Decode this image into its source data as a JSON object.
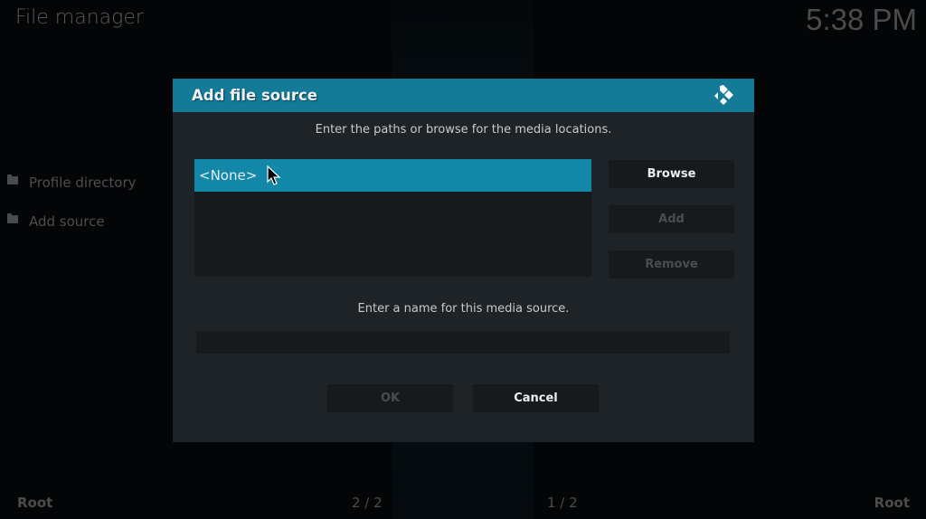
{
  "window": {
    "title": "File manager",
    "clock": "5:38 PM"
  },
  "left_panel": {
    "items": [
      {
        "label": "Profile directory",
        "icon": "folder-icon"
      },
      {
        "label": "Add source",
        "icon": "folder-icon"
      }
    ]
  },
  "footer": {
    "left_path": "Root",
    "left_count": "2 / 2",
    "right_count": "1 / 2",
    "right_path": "Root"
  },
  "dialog": {
    "title": "Add file source",
    "logo_icon": "kodi-logo-icon",
    "paths_prompt": "Enter the paths or browse for the media locations.",
    "paths": [
      "<None>"
    ],
    "buttons": {
      "browse": "Browse",
      "add": "Add",
      "remove": "Remove",
      "ok": "OK",
      "cancel": "Cancel"
    },
    "name_prompt": "Enter a name for this media source.",
    "name_value": "",
    "colors": {
      "accent": "#137a98",
      "selected": "#1287a8",
      "panel": "#1d2326"
    }
  }
}
